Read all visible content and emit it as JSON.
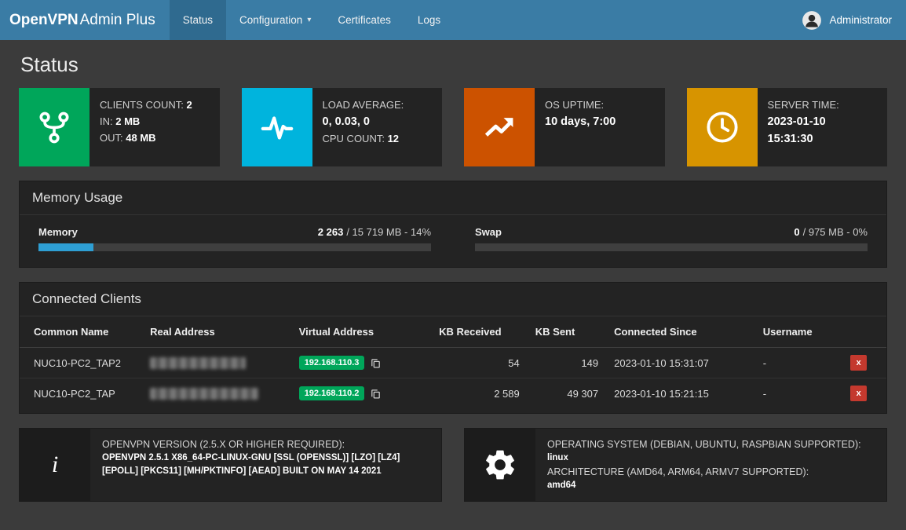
{
  "navbar": {
    "brand_bold": "OpenVPN",
    "brand_light": "Admin Plus",
    "items": [
      {
        "label": "Status"
      },
      {
        "label": "Configuration"
      },
      {
        "label": "Certificates"
      },
      {
        "label": "Logs"
      }
    ],
    "user": "Administrator"
  },
  "page": {
    "title": "Status"
  },
  "stats": {
    "clients": {
      "l1": "CLIENTS COUNT:",
      "v1": "2",
      "l2": "IN:",
      "v2": "2 MB",
      "l3": "OUT:",
      "v3": "48 MB"
    },
    "load": {
      "l1": "LOAD AVERAGE:",
      "v1": "0, 0.03, 0",
      "l2": "CPU COUNT:",
      "v2": "12"
    },
    "uptime": {
      "l1": "OS UPTIME:",
      "v1": "10 days, 7:00"
    },
    "time": {
      "l1": "SERVER TIME:",
      "v1": "2023-01-10",
      "v2": "15:31:30"
    }
  },
  "memory": {
    "title": "Memory Usage",
    "mem": {
      "label": "Memory",
      "used": "2 263",
      "detail": "/ 15 719 MB - 14%",
      "percent": 14
    },
    "swap": {
      "label": "Swap",
      "used": "0",
      "detail": "/ 975 MB - 0%",
      "percent": 0
    }
  },
  "clients": {
    "title": "Connected Clients",
    "headers": [
      "Common Name",
      "Real Address",
      "Virtual Address",
      "KB Received",
      "KB Sent",
      "Connected Since",
      "Username",
      ""
    ],
    "rows": [
      {
        "common_name": "NUC10-PC2_TAP2",
        "virtual_address": "192.168.110.3",
        "kb_received": "54",
        "kb_sent": "149",
        "connected_since": "2023-01-10 15:31:07",
        "username": "-"
      },
      {
        "common_name": "NUC10-PC2_TAP",
        "virtual_address": "192.168.110.2",
        "kb_received": "2 589",
        "kb_sent": "49 307",
        "connected_since": "2023-01-10 15:21:15",
        "username": "-"
      }
    ]
  },
  "info": {
    "version": {
      "label": "OPENVPN VERSION (2.5.X OR HIGHER REQUIRED):",
      "value": "OPENVPN 2.5.1 X86_64-PC-LINUX-GNU [SSL (OPENSSL)] [LZO] [LZ4] [EPOLL] [PKCS11] [MH/PKTINFO] [AEAD] BUILT ON MAY 14 2021"
    },
    "system": {
      "os_label": "OPERATING SYSTEM (DEBIAN, UBUNTU, RASPBIAN SUPPORTED):",
      "os_value": "linux",
      "arch_label": "ARCHITECTURE (AMD64, ARM64, ARMV7 SUPPORTED):",
      "arch_value": "amd64"
    }
  },
  "icons": {
    "close": "x",
    "caret": "▾",
    "info": "i"
  },
  "colors": {
    "navbar": "#3a7ca5",
    "green": "#00a65a",
    "cyan": "#00b4dd",
    "orange": "#cc5200",
    "amber": "#d79400",
    "red": "#c4392e",
    "progress_fill": "#2e9fd4",
    "badge": "#00a65a"
  }
}
